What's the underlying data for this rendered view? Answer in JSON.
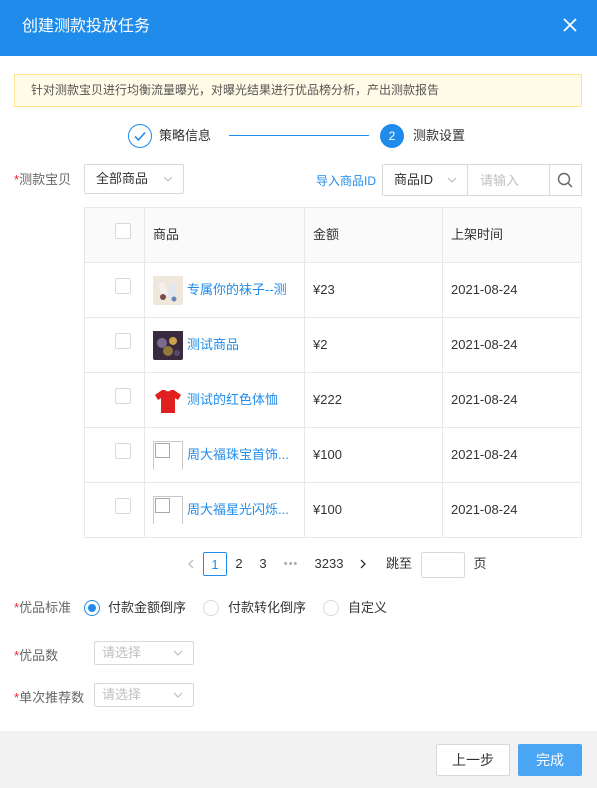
{
  "header": {
    "title": "创建测款投放任务"
  },
  "notice": {
    "text": "针对测款宝贝进行均衡流量曝光，对曝光结果进行优品榜分析，产出测款报告"
  },
  "steps": [
    {
      "label": "策略信息",
      "status": "done"
    },
    {
      "label": "测款设置",
      "number": "2",
      "status": "active"
    }
  ],
  "product_filter": {
    "required_mark": "*",
    "label": "测款宝贝",
    "scope_select": "全部商品",
    "import_link": "导入商品ID",
    "field_select": "商品ID",
    "search_placeholder": "请输入"
  },
  "table": {
    "columns": [
      "商品",
      "金额",
      "上架时间"
    ],
    "rows": [
      {
        "name": "专属你的袜子--测",
        "amount": "¥23",
        "date": "2021-08-24",
        "thumb": "socks"
      },
      {
        "name": "测试商品",
        "amount": "¥2",
        "date": "2021-08-24",
        "thumb": "photo"
      },
      {
        "name": "测试的红色体恤",
        "amount": "¥222",
        "date": "2021-08-24",
        "thumb": "red-tshirt"
      },
      {
        "name": "周大福珠宝首饰...",
        "amount": "¥100",
        "date": "2021-08-24",
        "thumb": "broken-image"
      },
      {
        "name": "周大福星光闪烁...",
        "amount": "¥100",
        "date": "2021-08-24",
        "thumb": "broken-image"
      }
    ]
  },
  "pagination": {
    "pages": [
      "1",
      "2",
      "3"
    ],
    "ellipsis": "•••",
    "last_page": "3233",
    "jump_label": "跳至",
    "page_unit": "页"
  },
  "quality_standard": {
    "required_mark": "*",
    "label": "优品标准",
    "options": [
      "付款金额倒序",
      "付款转化倒序",
      "自定义"
    ],
    "selected": "付款金额倒序"
  },
  "quality_count": {
    "required_mark": "*",
    "label": "优品数",
    "placeholder": "请选择"
  },
  "single_recommend": {
    "required_mark": "*",
    "label": "单次推荐数",
    "placeholder": "请选择"
  },
  "footer": {
    "prev_label": "上一步",
    "done_label": "完成"
  },
  "colors": {
    "primary": "#1f8ceb",
    "required": "#f5222d",
    "notice_bg": "#fffbe6"
  }
}
